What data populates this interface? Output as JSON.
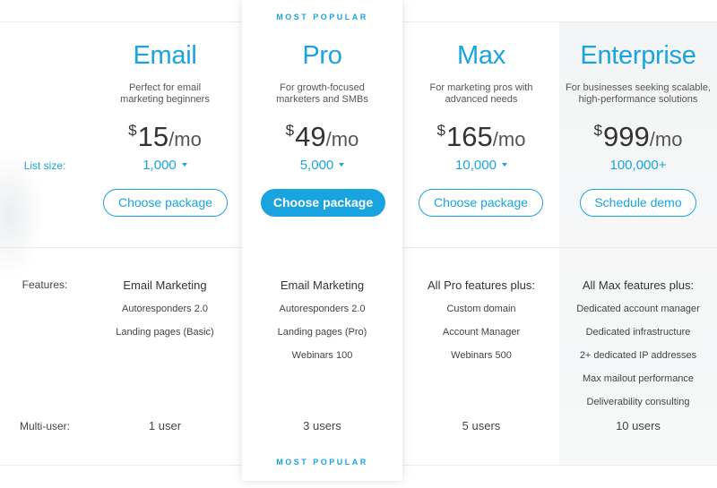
{
  "labels": {
    "list_size": "List size:",
    "features": "Features:",
    "multi_user": "Multi-user:"
  },
  "badges": {
    "top": "MOST POPULAR",
    "bottom": "MOST POPULAR"
  },
  "colors": {
    "accent": "#1aa4df",
    "text": "#333333",
    "enterprise_bg": "#f4f5f6"
  },
  "plans": [
    {
      "name": "Email",
      "description": "Perfect for email marketing beginners",
      "currency": "$",
      "amount": "15",
      "period": "/mo",
      "list_size": "1,000",
      "button": "Choose package",
      "features_header": "Email Marketing",
      "features": [
        "Autoresponders 2.0",
        "Landing pages (Basic)"
      ],
      "users": "1 user"
    },
    {
      "name": "Pro",
      "description": "For growth-focused marketers and SMBs",
      "currency": "$",
      "amount": "49",
      "period": "/mo",
      "list_size": "5,000",
      "button": "Choose package",
      "features_header": "Email Marketing",
      "features": [
        "Autoresponders 2.0",
        "Landing pages (Pro)",
        "Webinars 100"
      ],
      "users": "3 users"
    },
    {
      "name": "Max",
      "description": "For marketing pros with advanced needs",
      "currency": "$",
      "amount": "165",
      "period": "/mo",
      "list_size": "10,000",
      "button": "Choose package",
      "features_header": "All Pro features plus:",
      "features": [
        "Custom domain",
        "Account Manager",
        "Webinars 500"
      ],
      "users": "5 users"
    },
    {
      "name": "Enterprise",
      "description": "For businesses seeking scalable, high-performance solutions",
      "currency": "$",
      "amount": "999",
      "period": "/mo",
      "list_size": "100,000+",
      "button": "Schedule demo",
      "features_header": "All Max features plus:",
      "features": [
        "Dedicated account manager",
        "Dedicated infrastructure",
        "2+ dedicated IP addresses",
        "Max mailout performance",
        "Deliverability consulting"
      ],
      "users": "10 users"
    }
  ]
}
